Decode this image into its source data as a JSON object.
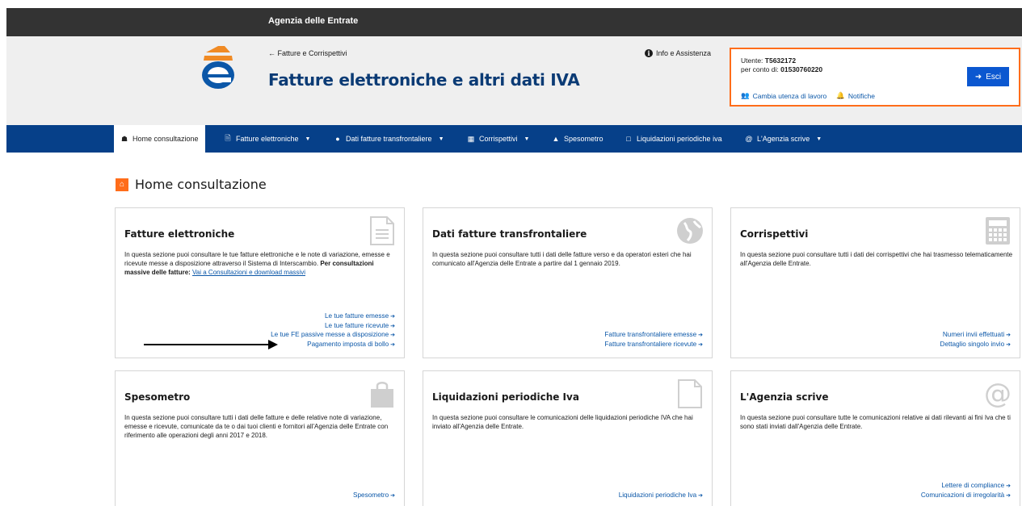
{
  "topbar": {
    "title": "Agenzia delle Entrate"
  },
  "header": {
    "back_link": "← Fatture e Corrispettivi",
    "title": "Fatture elettroniche e altri dati IVA",
    "info_label": "Info e Assistenza"
  },
  "user": {
    "utente_label": "Utente: ",
    "utente_value": "T5632172",
    "conto_label": "per conto di: ",
    "conto_value": "01530760220",
    "change_label": "Cambia utenza di lavoro",
    "notifiche_label": "Notifiche",
    "logout_label": "Esci"
  },
  "nav": {
    "items": [
      {
        "label": "Home consultazione",
        "icon": "home-icon"
      },
      {
        "label": "Fatture elettroniche",
        "icon": "document-icon"
      },
      {
        "label": "Dati fatture transfrontaliere",
        "icon": "globe-icon"
      },
      {
        "label": "Corrispettivi",
        "icon": "calculator-icon"
      },
      {
        "label": "Spesometro",
        "icon": "bag-icon"
      },
      {
        "label": "Liquidazioni periodiche iva",
        "icon": "file-icon"
      },
      {
        "label": "L'Agenzia scrive",
        "icon": "at-icon"
      }
    ]
  },
  "main": {
    "title": "Home consultazione"
  },
  "cards": {
    "fatture": {
      "title": "Fatture elettroniche",
      "desc_1": "In questa sezione puoi consultare le tue fatture elettroniche e le note di variazione, emesse e ricevute messe a disposizione attraverso il Sistema di Interscambio. ",
      "desc_bold": "Per consultazioni massive delle fatture:",
      "desc_link": "Vai a Consultazioni e download massivi",
      "links": [
        "Le tue fatture emesse",
        "Le tue fatture ricevute",
        "Le tue FE passive messe a disposizione",
        "Pagamento imposta di bollo"
      ]
    },
    "transfrontaliere": {
      "title": "Dati fatture transfrontaliere",
      "desc": "In questa sezione puoi consultare tutti i dati delle fatture verso e da operatori esteri che hai comunicato all'Agenzia delle Entrate a partire dal 1 gennaio 2019.",
      "links": [
        "Fatture transfrontaliere emesse",
        "Fatture transfrontaliere ricevute"
      ]
    },
    "corrispettivi": {
      "title": "Corrispettivi",
      "desc": "In questa sezione puoi consultare tutti i dati dei corrispettivi che hai trasmesso telematicamente all'Agenzia delle Entrate.",
      "links": [
        "Numeri invii effettuati",
        "Dettaglio singolo invio"
      ]
    },
    "spesometro": {
      "title": "Spesometro",
      "desc": "In questa sezione puoi consultare tutti i dati delle fatture e delle relative note di variazione, emesse e ricevute, comunicate da te o dai tuoi clienti e fornitori all'Agenzia delle Entrate con riferimento alle operazioni degli anni 2017 e 2018.",
      "links": [
        "Spesometro"
      ]
    },
    "liquidazioni": {
      "title": "Liquidazioni periodiche Iva",
      "desc": "In questa sezione puoi consultare le comunicazioni delle liquidazioni periodiche IVA che hai inviato all'Agenzia delle Entrate.",
      "links": [
        "Liquidazioni periodiche Iva"
      ]
    },
    "agenzia": {
      "title": "L'Agenzia scrive",
      "desc": "In questa sezione puoi consultare tutte le comunicazioni relative ai dati rilevanti ai fini Iva che ti sono stati inviati dall'Agenzia delle Entrate.",
      "links": [
        "Lettere di compliance",
        "Comunicazioni di irregolarità"
      ]
    }
  },
  "colors": {
    "accent": "#ff6d1a",
    "nav": "#064089",
    "link": "#0b57a8",
    "title": "#0b3b75"
  }
}
